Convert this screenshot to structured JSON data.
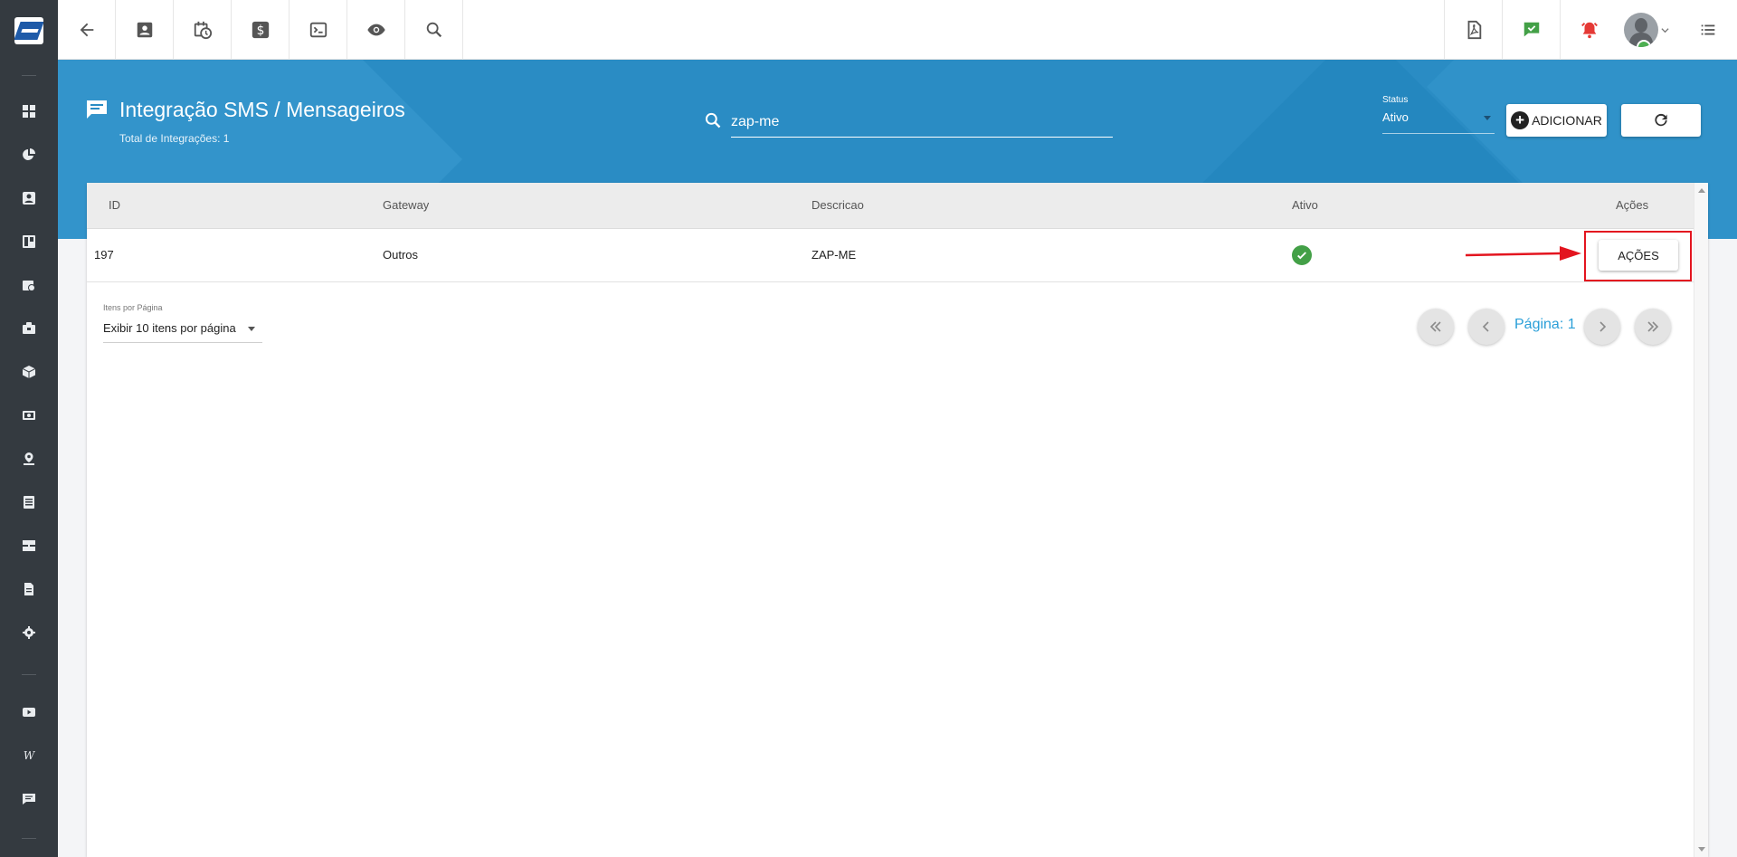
{
  "sidebar": {
    "items": [
      {
        "icon": "dashboard-icon"
      },
      {
        "icon": "pie-chart-icon"
      },
      {
        "icon": "contact-card-icon"
      },
      {
        "icon": "board-icon"
      },
      {
        "icon": "calendar-clock-icon"
      },
      {
        "icon": "briefcase-icon"
      },
      {
        "icon": "package-icon"
      },
      {
        "icon": "money-icon"
      },
      {
        "icon": "location-pin-icon"
      },
      {
        "icon": "list-icon"
      },
      {
        "icon": "server-icon"
      },
      {
        "icon": "document-icon"
      },
      {
        "icon": "gear-icon"
      },
      {
        "icon": "video-icon"
      },
      {
        "icon": "wiki-icon",
        "text": "W"
      },
      {
        "icon": "chat-icon"
      }
    ]
  },
  "topbar": {
    "left_icons": [
      "back-arrow-icon",
      "contact-icon",
      "calendar-clock-icon",
      "dollar-icon",
      "terminal-icon",
      "eye-icon",
      "search-icon"
    ],
    "right_icons": [
      "pdf-icon",
      "chat-check-icon",
      "alarm-icon",
      "avatar",
      "menu-list-icon"
    ]
  },
  "header": {
    "title": "Integração SMS / Mensageiros",
    "subtitle": "Total de Integrações: 1",
    "search_value": "zap-me",
    "status_label": "Status",
    "status_value": "Ativo",
    "add_label": "ADICIONAR"
  },
  "table": {
    "headers": {
      "id": "ID",
      "gateway": "Gateway",
      "descricao": "Descricao",
      "ativo": "Ativo",
      "acoes": "Ações"
    },
    "rows": [
      {
        "id": "197",
        "gateway": "Outros",
        "descricao": "ZAP-ME",
        "ativo": true,
        "action_label": "AÇÕES"
      }
    ]
  },
  "pagination": {
    "items_per_page_label": "Itens por Página",
    "items_per_page_value": "Exibir 10 itens por página",
    "page_label": "Página: 1"
  },
  "colors": {
    "sidebar": "#343a40",
    "header_band": "#2a8cc4",
    "active_green": "#43a047",
    "highlight_red": "#e3151f",
    "page_link": "#2a9fd8"
  }
}
